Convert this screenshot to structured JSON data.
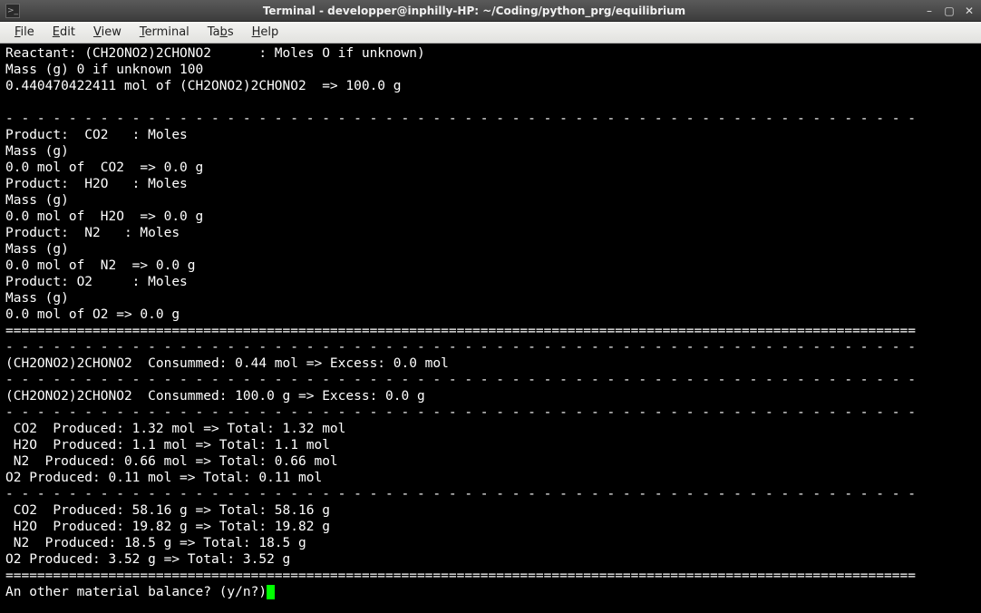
{
  "window": {
    "title": "Terminal - developper@inphilly-HP: ~/Coding/python_prg/equilibrium",
    "app_icon_glyph": ">_"
  },
  "menubar": {
    "file": "File",
    "edit": "Edit",
    "view": "View",
    "terminal": "Terminal",
    "tabs": "Tabs",
    "help": "Help"
  },
  "terminal": {
    "lines": [
      "Reactant: (CH2ONO2)2CHONO2      : Moles O if unknown)",
      "Mass (g) 0 if unknown 100",
      "0.440470422411 mol of (CH2ONO2)2CHONO2  => 100.0 g",
      "",
      "- - - - - - - - - - - - - - - - - - - - - - - - - - - - - - - - - - - - - - - - - - - - - - - - - - - - - - - - - -",
      "Product:  CO2   : Moles",
      "Mass (g)",
      "0.0 mol of  CO2  => 0.0 g",
      "Product:  H2O   : Moles",
      "Mass (g)",
      "0.0 mol of  H2O  => 0.0 g",
      "Product:  N2   : Moles",
      "Mass (g)",
      "0.0 mol of  N2  => 0.0 g",
      "Product: O2     : Moles",
      "Mass (g)",
      "0.0 mol of O2 => 0.0 g",
      "===================================================================================================================",
      "- - - - - - - - - - - - - - - - - - - - - - - - - - - - - - - - - - - - - - - - - - - - - - - - - - - - - - - - - -",
      "(CH2ONO2)2CHONO2  Consummed: 0.44 mol => Excess: 0.0 mol",
      "- - - - - - - - - - - - - - - - - - - - - - - - - - - - - - - - - - - - - - - - - - - - - - - - - - - - - - - - - -",
      "(CH2ONO2)2CHONO2  Consummed: 100.0 g => Excess: 0.0 g",
      "- - - - - - - - - - - - - - - - - - - - - - - - - - - - - - - - - - - - - - - - - - - - - - - - - - - - - - - - - -",
      " CO2  Produced: 1.32 mol => Total: 1.32 mol",
      " H2O  Produced: 1.1 mol => Total: 1.1 mol",
      " N2  Produced: 0.66 mol => Total: 0.66 mol",
      "O2 Produced: 0.11 mol => Total: 0.11 mol",
      "- - - - - - - - - - - - - - - - - - - - - - - - - - - - - - - - - - - - - - - - - - - - - - - - - - - - - - - - - -",
      " CO2  Produced: 58.16 g => Total: 58.16 g",
      " H2O  Produced: 19.82 g => Total: 19.82 g",
      " N2  Produced: 18.5 g => Total: 18.5 g",
      "O2 Produced: 3.52 g => Total: 3.52 g",
      "==================================================================================================================="
    ],
    "prompt": "An other material balance? (y/n?)"
  }
}
